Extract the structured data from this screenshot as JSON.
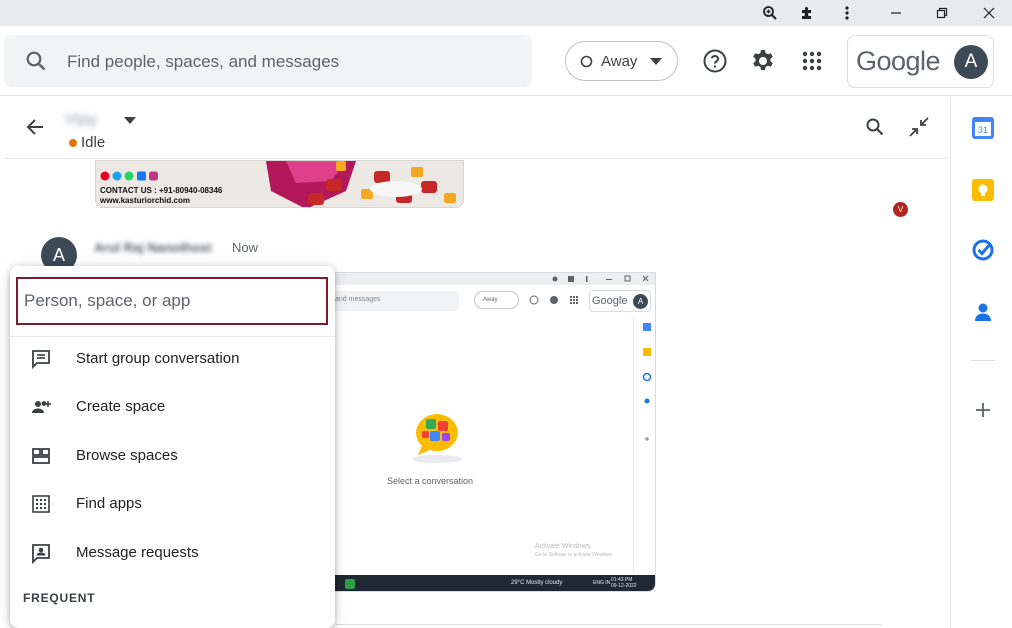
{
  "header": {
    "search_placeholder": "Find people, spaces, and messages",
    "status_label": "Away",
    "brand": "Google",
    "avatar_letter": "A"
  },
  "conversation": {
    "contact_name": "Vijay",
    "status": "Idle",
    "banner_contact_line": "CONTACT US : +91-80940-08346",
    "banner_site": "www.kasturiorchid.com",
    "reaction_badge": "V",
    "sender_avatar_letter": "A",
    "sender_name": "Arul Raj Nanothost",
    "time": "Now"
  },
  "embedded_screenshot": {
    "search_text": "and messages",
    "status": "Away",
    "brand": "Google",
    "avatar_letter": "A",
    "empty_state": "Select a conversation",
    "watermark_title": "Activate Windows",
    "watermark_sub": "Go to Settings to activate Windows.",
    "weather": "29°C  Mostly cloudy",
    "time": "01:43 PM",
    "date": "09-12-2022",
    "lang": "ENG IN"
  },
  "new_chat_menu": {
    "input_placeholder": "Person, space, or app",
    "items": [
      {
        "label": "Start group conversation",
        "icon": "group-chat-icon"
      },
      {
        "label": "Create space",
        "icon": "create-space-icon"
      },
      {
        "label": "Browse spaces",
        "icon": "browse-spaces-icon"
      },
      {
        "label": "Find apps",
        "icon": "apps-grid-icon"
      },
      {
        "label": "Message requests",
        "icon": "message-requests-icon"
      }
    ],
    "section_label": "FREQUENT"
  },
  "right_rail": {
    "calendar_day": "31"
  },
  "colors": {
    "accent_border": "#7f1d2c",
    "idle": "#e37400",
    "avatar_bg": "#3c4a57",
    "badge": "#b3261e"
  }
}
